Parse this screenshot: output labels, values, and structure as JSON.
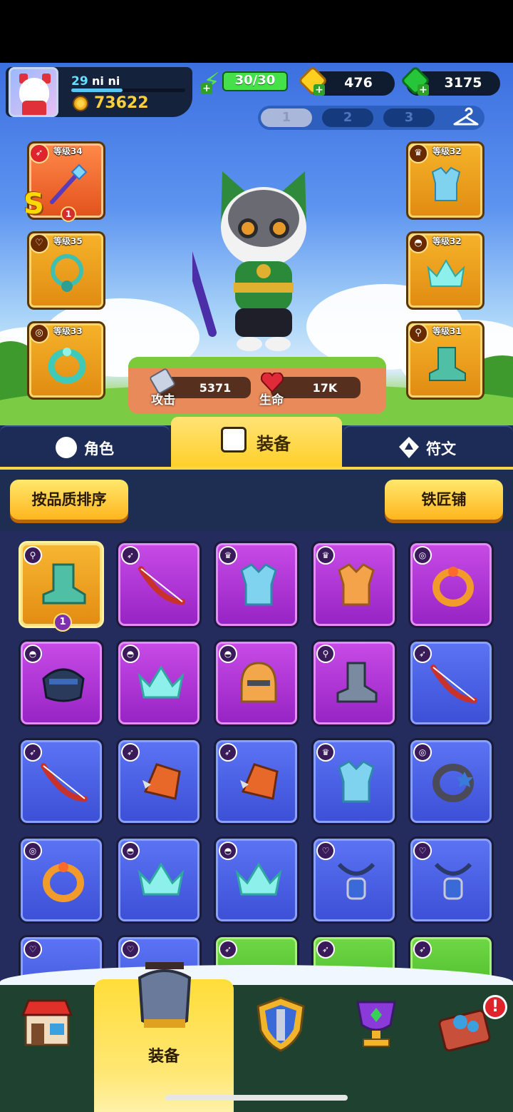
{
  "player": {
    "level": "29",
    "name": "ni ni",
    "xp_fraction": 0.45
  },
  "currencies": {
    "gold": "73622",
    "energy": "30/30",
    "coins": "476",
    "gems": "3175"
  },
  "loadout_tabs": [
    {
      "label": "1",
      "active": true
    },
    {
      "label": "2",
      "active": false
    },
    {
      "label": "3",
      "active": false
    }
  ],
  "equipped_left": [
    {
      "label": "等级34",
      "rank": "S",
      "badge": "1"
    },
    {
      "label": "等级35"
    },
    {
      "label": "等级33"
    }
  ],
  "equipped_right": [
    {
      "label": "等级32"
    },
    {
      "label": "等级32"
    },
    {
      "label": "等级31"
    }
  ],
  "stats": {
    "attack_label": "攻击",
    "attack_value": "5371",
    "hp_label": "生命",
    "hp_value": "17K"
  },
  "tabs": {
    "role": "角色",
    "equipment": "装备",
    "rune": "符文"
  },
  "buttons": {
    "sort": "按品质排序",
    "smith": "铁匠铺"
  },
  "inventory_badge": "1",
  "bottom_nav": {
    "active_label": "装备",
    "alert": "!"
  },
  "colors": {
    "accent_yellow": "#ffd23a",
    "panel": "#1e2d52",
    "purple": "#b03ad8",
    "blue": "#4a5fe4",
    "green": "#5cc935"
  }
}
